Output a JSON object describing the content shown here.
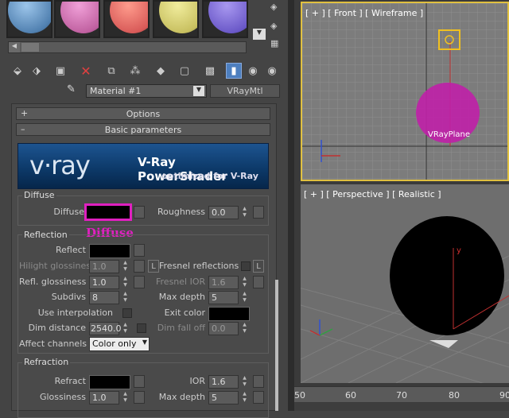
{
  "material_slots": [
    {
      "color": "#6c9cc8"
    },
    {
      "color": "#d070b0"
    },
    {
      "color": "#e26565"
    },
    {
      "color": "#d6d070"
    },
    {
      "color": "#7d6ad6"
    }
  ],
  "material_name": "Material #1",
  "material_type": "VRayMtl",
  "rollouts": {
    "options": {
      "sign": "+",
      "label": "Options"
    },
    "basic": {
      "sign": "–",
      "label": "Basic parameters"
    }
  },
  "banner": {
    "logo": "v·ray",
    "title": "V-Ray PowerShader",
    "subtitle": "optimized for V-Ray"
  },
  "diffuse": {
    "group_title": "Diffuse",
    "label": "Diffuse",
    "roughness_label": "Roughness",
    "roughness_value": "0.0",
    "annotation": "Diffuse"
  },
  "reflection": {
    "group_title": "Reflection",
    "reflect_label": "Reflect",
    "hilight_label": "Hilight glossiness",
    "hilight_value": "1.0",
    "fresnel_label": "Fresnel reflections",
    "refl_gloss_label": "Refl. glossiness",
    "refl_gloss_value": "1.0",
    "fresnel_ior_label": "Fresnel IOR",
    "fresnel_ior_value": "1.6",
    "subdivs_label": "Subdivs",
    "subdivs_value": "8",
    "max_depth_label": "Max depth",
    "max_depth_value": "5",
    "use_interp_label": "Use interpolation",
    "exit_color_label": "Exit color",
    "dim_distance_label": "Dim distance",
    "dim_distance_value": "2540.0",
    "dim_falloff_label": "Dim fall off",
    "dim_falloff_value": "0.0",
    "affect_channels_label": "Affect channels",
    "affect_channels_value": "Color only"
  },
  "refraction": {
    "group_title": "Refraction",
    "refract_label": "Refract",
    "ior_label": "IOR",
    "ior_value": "1.6",
    "glossiness_label": "Glossiness",
    "glossiness_value": "1.0",
    "max_depth_label": "Max depth",
    "max_depth_value": "5"
  },
  "viewports": {
    "front": {
      "label": "[ + ] [ Front ] [ Wireframe ]",
      "object_label": "VRayPlane"
    },
    "perspective": {
      "label": "[ + ] [ Perspective ] [ Realistic ]",
      "axis_y": "y"
    }
  },
  "timeline": {
    "ticks": [
      "50",
      "60",
      "70",
      "80",
      "90"
    ]
  },
  "colors": {
    "accent": "#e020c0",
    "banner": "#0d3a6a"
  }
}
